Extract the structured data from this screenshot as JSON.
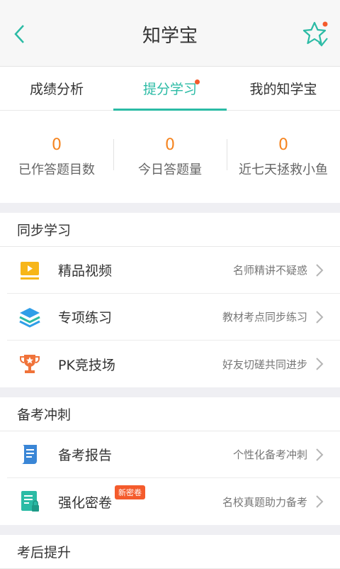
{
  "header": {
    "title": "知学宝"
  },
  "tabs": [
    {
      "label": "成绩分析"
    },
    {
      "label": "提分学习"
    },
    {
      "label": "我的知学宝"
    }
  ],
  "stats": [
    {
      "value": "0",
      "label": "已作答题目数"
    },
    {
      "value": "0",
      "label": "今日答题量"
    },
    {
      "value": "0",
      "label": "近七天拯救小鱼"
    }
  ],
  "sections": [
    {
      "title": "同步学习",
      "items": [
        {
          "label": "精品视频",
          "hint": "名师精讲不疑惑",
          "icon": "video-icon"
        },
        {
          "label": "专项练习",
          "hint": "教材考点同步练习",
          "icon": "layers-icon"
        },
        {
          "label": "PK竞技场",
          "hint": "好友切磋共同进步",
          "icon": "trophy-icon"
        }
      ]
    },
    {
      "title": "备考冲刺",
      "items": [
        {
          "label": "备考报告",
          "hint": "个性化备考冲刺",
          "icon": "report-icon"
        },
        {
          "label": "强化密卷",
          "hint": "名校真题助力备考",
          "icon": "paper-icon",
          "badge": "新密卷"
        }
      ]
    },
    {
      "title": "考后提升",
      "items": []
    }
  ],
  "colors": {
    "accent": "#2bbba5",
    "number": "#f5841f",
    "dot": "#f45b2c"
  }
}
